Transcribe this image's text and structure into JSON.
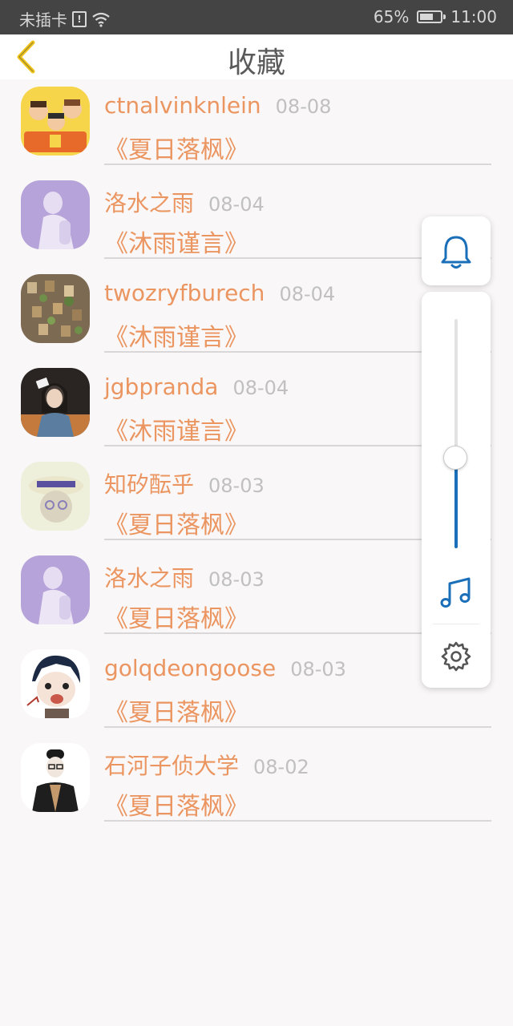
{
  "status_bar": {
    "carrier": "未插卡",
    "battery": "65%",
    "battery_level": 0.65,
    "time": "11:00",
    "icons": [
      "sim-alert-icon",
      "wifi-icon",
      "battery-icon"
    ]
  },
  "header": {
    "title": "收藏",
    "back_icon": "chevron-left-icon"
  },
  "colors": {
    "accent": "#eb9560",
    "back_arrow": "#f0c419",
    "date": "#c0c0c0",
    "control_blue": "#1a6fb8"
  },
  "favorites": [
    {
      "user": "ctnalvinknlein",
      "date": "08-08",
      "article": "《夏日落枫》",
      "avatar": "family-cartoon-avatar"
    },
    {
      "user": "洛水之雨",
      "date": "08-04",
      "article": "《沐雨谨言》",
      "avatar": "purple-girl-avatar"
    },
    {
      "user": "twozryfburech",
      "date": "08-04",
      "article": "《沐雨谨言》",
      "avatar": "birdhouse-wall-avatar"
    },
    {
      "user": "jgbpranda",
      "date": "08-04",
      "article": "《沐雨谨言》",
      "avatar": "woman-window-avatar"
    },
    {
      "user": "知矽酝乎",
      "date": "08-03",
      "article": "《夏日落枫》",
      "avatar": "hat-girl-avatar"
    },
    {
      "user": "洛水之雨",
      "date": "08-03",
      "article": "《夏日落枫》",
      "avatar": "purple-girl-avatar"
    },
    {
      "user": "golqdeongoose",
      "date": "08-03",
      "article": "《夏日落枫》",
      "avatar": "anime-face-avatar"
    },
    {
      "user": "石河子侦大学",
      "date": "08-02",
      "article": "《夏日落枫》",
      "avatar": "man-beanie-avatar"
    }
  ],
  "volume_panel": {
    "bell_icon": "bell-icon",
    "volume_level": 0.4,
    "music_icon": "music-note-icon",
    "settings_icon": "gear-icon"
  }
}
